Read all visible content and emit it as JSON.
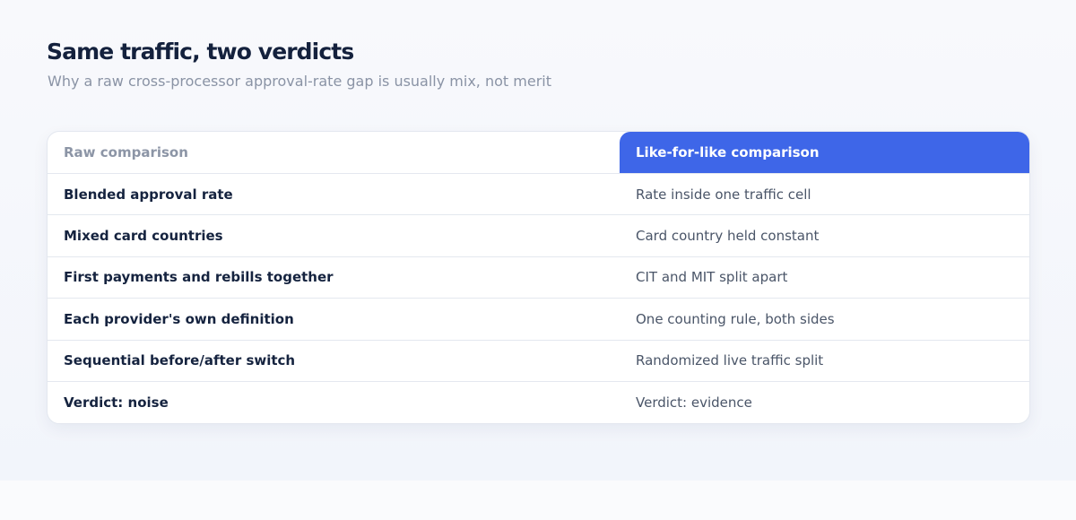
{
  "page": {
    "title": "Same traffic, two verdicts",
    "subtitle": "Why a raw cross-processor approval-rate gap is usually mix, not merit"
  },
  "table": {
    "headers": [
      "Raw comparison",
      "Like-for-like comparison"
    ],
    "rows": [
      [
        "Blended approval rate",
        "Rate inside one traffic cell"
      ],
      [
        "Mixed card countries",
        "Card country held constant"
      ],
      [
        "First payments and rebills together",
        "CIT and MIT split apart"
      ],
      [
        "Each provider's own definition",
        "One counting rule, both sides"
      ],
      [
        "Sequential before/after switch",
        "Randomized live traffic split"
      ],
      [
        "Verdict: noise",
        "Verdict: evidence"
      ]
    ]
  },
  "colors": {
    "accent": "#3e66e8",
    "title": "#14213d",
    "subtitle": "#8a93a5",
    "header_muted": "#8c95a6",
    "body_text": "#4a5568",
    "border": "#e4e8ef"
  }
}
